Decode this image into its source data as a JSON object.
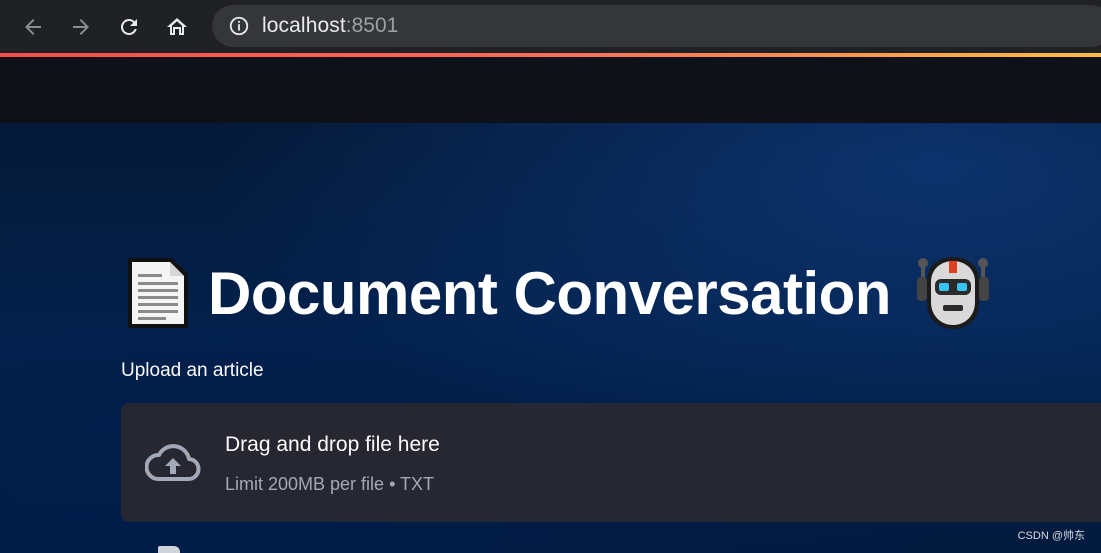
{
  "browser": {
    "url_host": "localhost",
    "url_port": ":8501"
  },
  "colors": {
    "accent_gradient_start": "#ff4b4b",
    "accent_gradient_end": "#ffbd45",
    "background": "#0e1117",
    "dropzone": "#262730"
  },
  "page": {
    "title": "Document Conversation",
    "title_leading_icon": "document-icon",
    "title_trailing_icon": "robot-icon"
  },
  "uploader": {
    "label": "Upload an article",
    "drop_title": "Drag and drop file here",
    "drop_subtitle": "Limit 200MB per file • TXT",
    "icon": "cloud-upload-icon"
  },
  "watermark": "CSDN @帅东"
}
